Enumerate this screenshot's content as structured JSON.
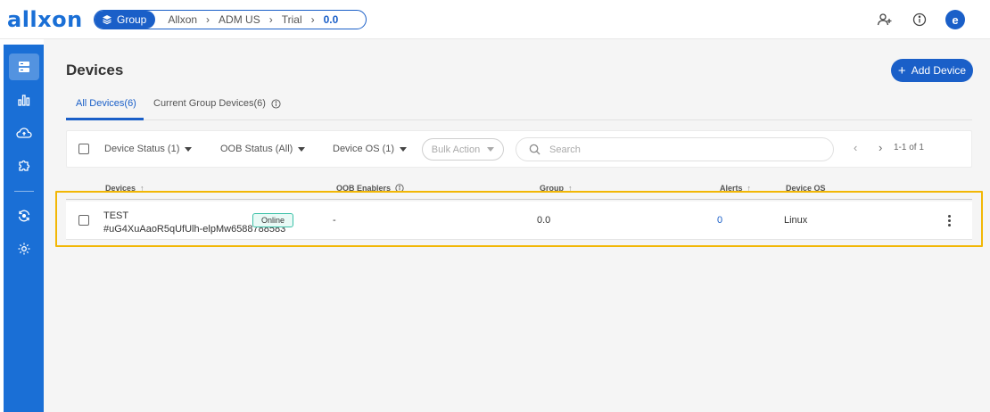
{
  "app": {
    "logo": "allxon"
  },
  "breadcrumb": {
    "group_label": "Group",
    "items": [
      "Allxon",
      "ADM US",
      "Trial"
    ],
    "current": "0.0"
  },
  "header_icons": [
    "add-user-icon",
    "info-icon"
  ],
  "user": {
    "avatar_letter": "e"
  },
  "sidebar": {
    "items": [
      {
        "icon": "devices-icon",
        "active": true
      },
      {
        "icon": "bar-chart-icon",
        "active": false
      },
      {
        "icon": "cloud-icon",
        "active": false
      },
      {
        "icon": "puzzle-icon",
        "active": false
      },
      {
        "icon": "sync-icon",
        "active": false
      },
      {
        "icon": "gear-icon",
        "active": false
      }
    ]
  },
  "page": {
    "title": "Devices",
    "add_button": "Add Device",
    "tabs": [
      {
        "label": "All Devices(6)",
        "active": true
      },
      {
        "label": "Current Group Devices(6)",
        "active": false
      }
    ]
  },
  "filters": {
    "device_status": "Device Status (1)",
    "oob_status": "OOB Status (All)",
    "device_os": "Device OS (1)",
    "bulk_action": "Bulk Action",
    "search_placeholder": "Search",
    "pagination": "1-1 of 1"
  },
  "table": {
    "columns": {
      "devices": "Devices",
      "oob_enablers": "OOB Enablers",
      "group": "Group",
      "alerts": "Alerts",
      "device_os": "Device OS"
    },
    "rows": [
      {
        "name": "TEST",
        "id": "#uG4XuAaoR5qUfUlh-elpMw6588788583",
        "status": "Online",
        "oob": "-",
        "group": "0.0",
        "alerts": "0",
        "os": "Linux"
      }
    ]
  },
  "colors": {
    "brand": "#1a6fd6",
    "primary": "#1a5fc8",
    "online": "#17a389",
    "highlight": "#f2b705"
  }
}
